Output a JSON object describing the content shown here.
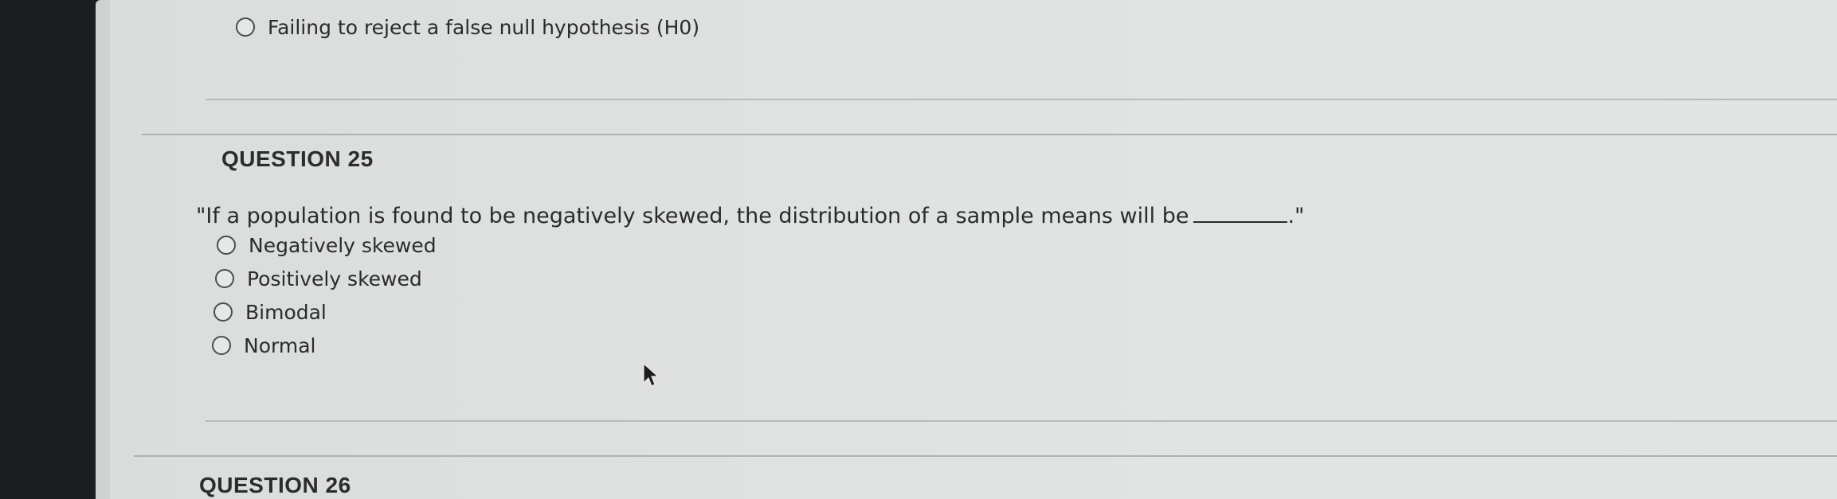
{
  "previous_question": {
    "options": [
      {
        "label": "Failing to reject a false null hypothesis (H0)"
      }
    ]
  },
  "question_25": {
    "heading": "QUESTION 25",
    "text": "\"If a population is found to be negatively skewed, the distribution of a sample means will be",
    "text_end": ".\"",
    "options": [
      {
        "label": "Negatively skewed"
      },
      {
        "label": "Positively skewed"
      },
      {
        "label": "Bimodal"
      },
      {
        "label": "Normal"
      }
    ]
  },
  "question_26": {
    "heading": "QUESTION 26"
  }
}
